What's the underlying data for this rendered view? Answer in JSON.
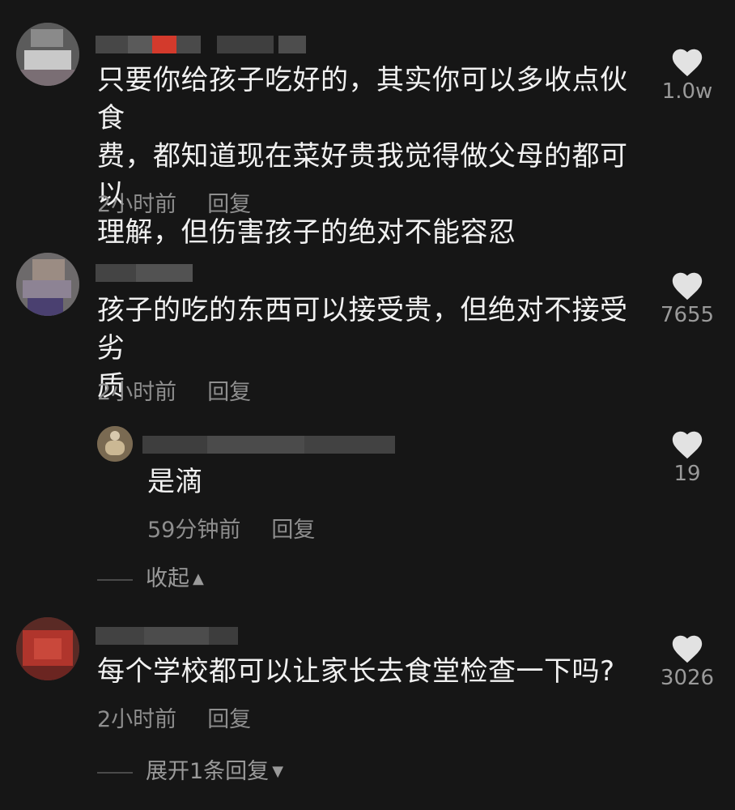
{
  "comments": [
    {
      "text": "只要你给孩子吃好的，其实你可以多收点伙食费，都知道现在菜好贵我觉得做父母的都可以理解，但伤害孩子的绝对不能容忍",
      "line1": "只要你给孩子吃好的，其实你可以多收点伙食",
      "line2": "费，都知道现在菜好贵我觉得做父母的都可以",
      "line3": "理解，但伤害孩子的绝对不能容忍",
      "time": "2小时前",
      "reply_label": "回复",
      "likes": "1.0w",
      "icon": "heart-icon"
    },
    {
      "text": "孩子的吃的东西可以接受贵，但绝对不接受劣质",
      "line1": "孩子的吃的东西可以接受贵，但绝对不接受劣",
      "line2": "质",
      "time": "2小时前",
      "reply_label": "回复",
      "likes": "7655",
      "icon": "heart-icon",
      "replies": [
        {
          "text": "是滴",
          "time": "59分钟前",
          "reply_label": "回复",
          "likes": "19",
          "icon": "heart-icon"
        }
      ],
      "collapse_label": "收起"
    },
    {
      "text": "每个学校都可以让家长去食堂检查一下吗?",
      "time": "2小时前",
      "reply_label": "回复",
      "likes": "3026",
      "icon": "heart-icon",
      "expand_label": "展开1条回复"
    }
  ],
  "colors": {
    "background": "#161616",
    "text": "#f1f1f1",
    "meta": "#8e8e8e",
    "heart": "#e2e2e2"
  }
}
